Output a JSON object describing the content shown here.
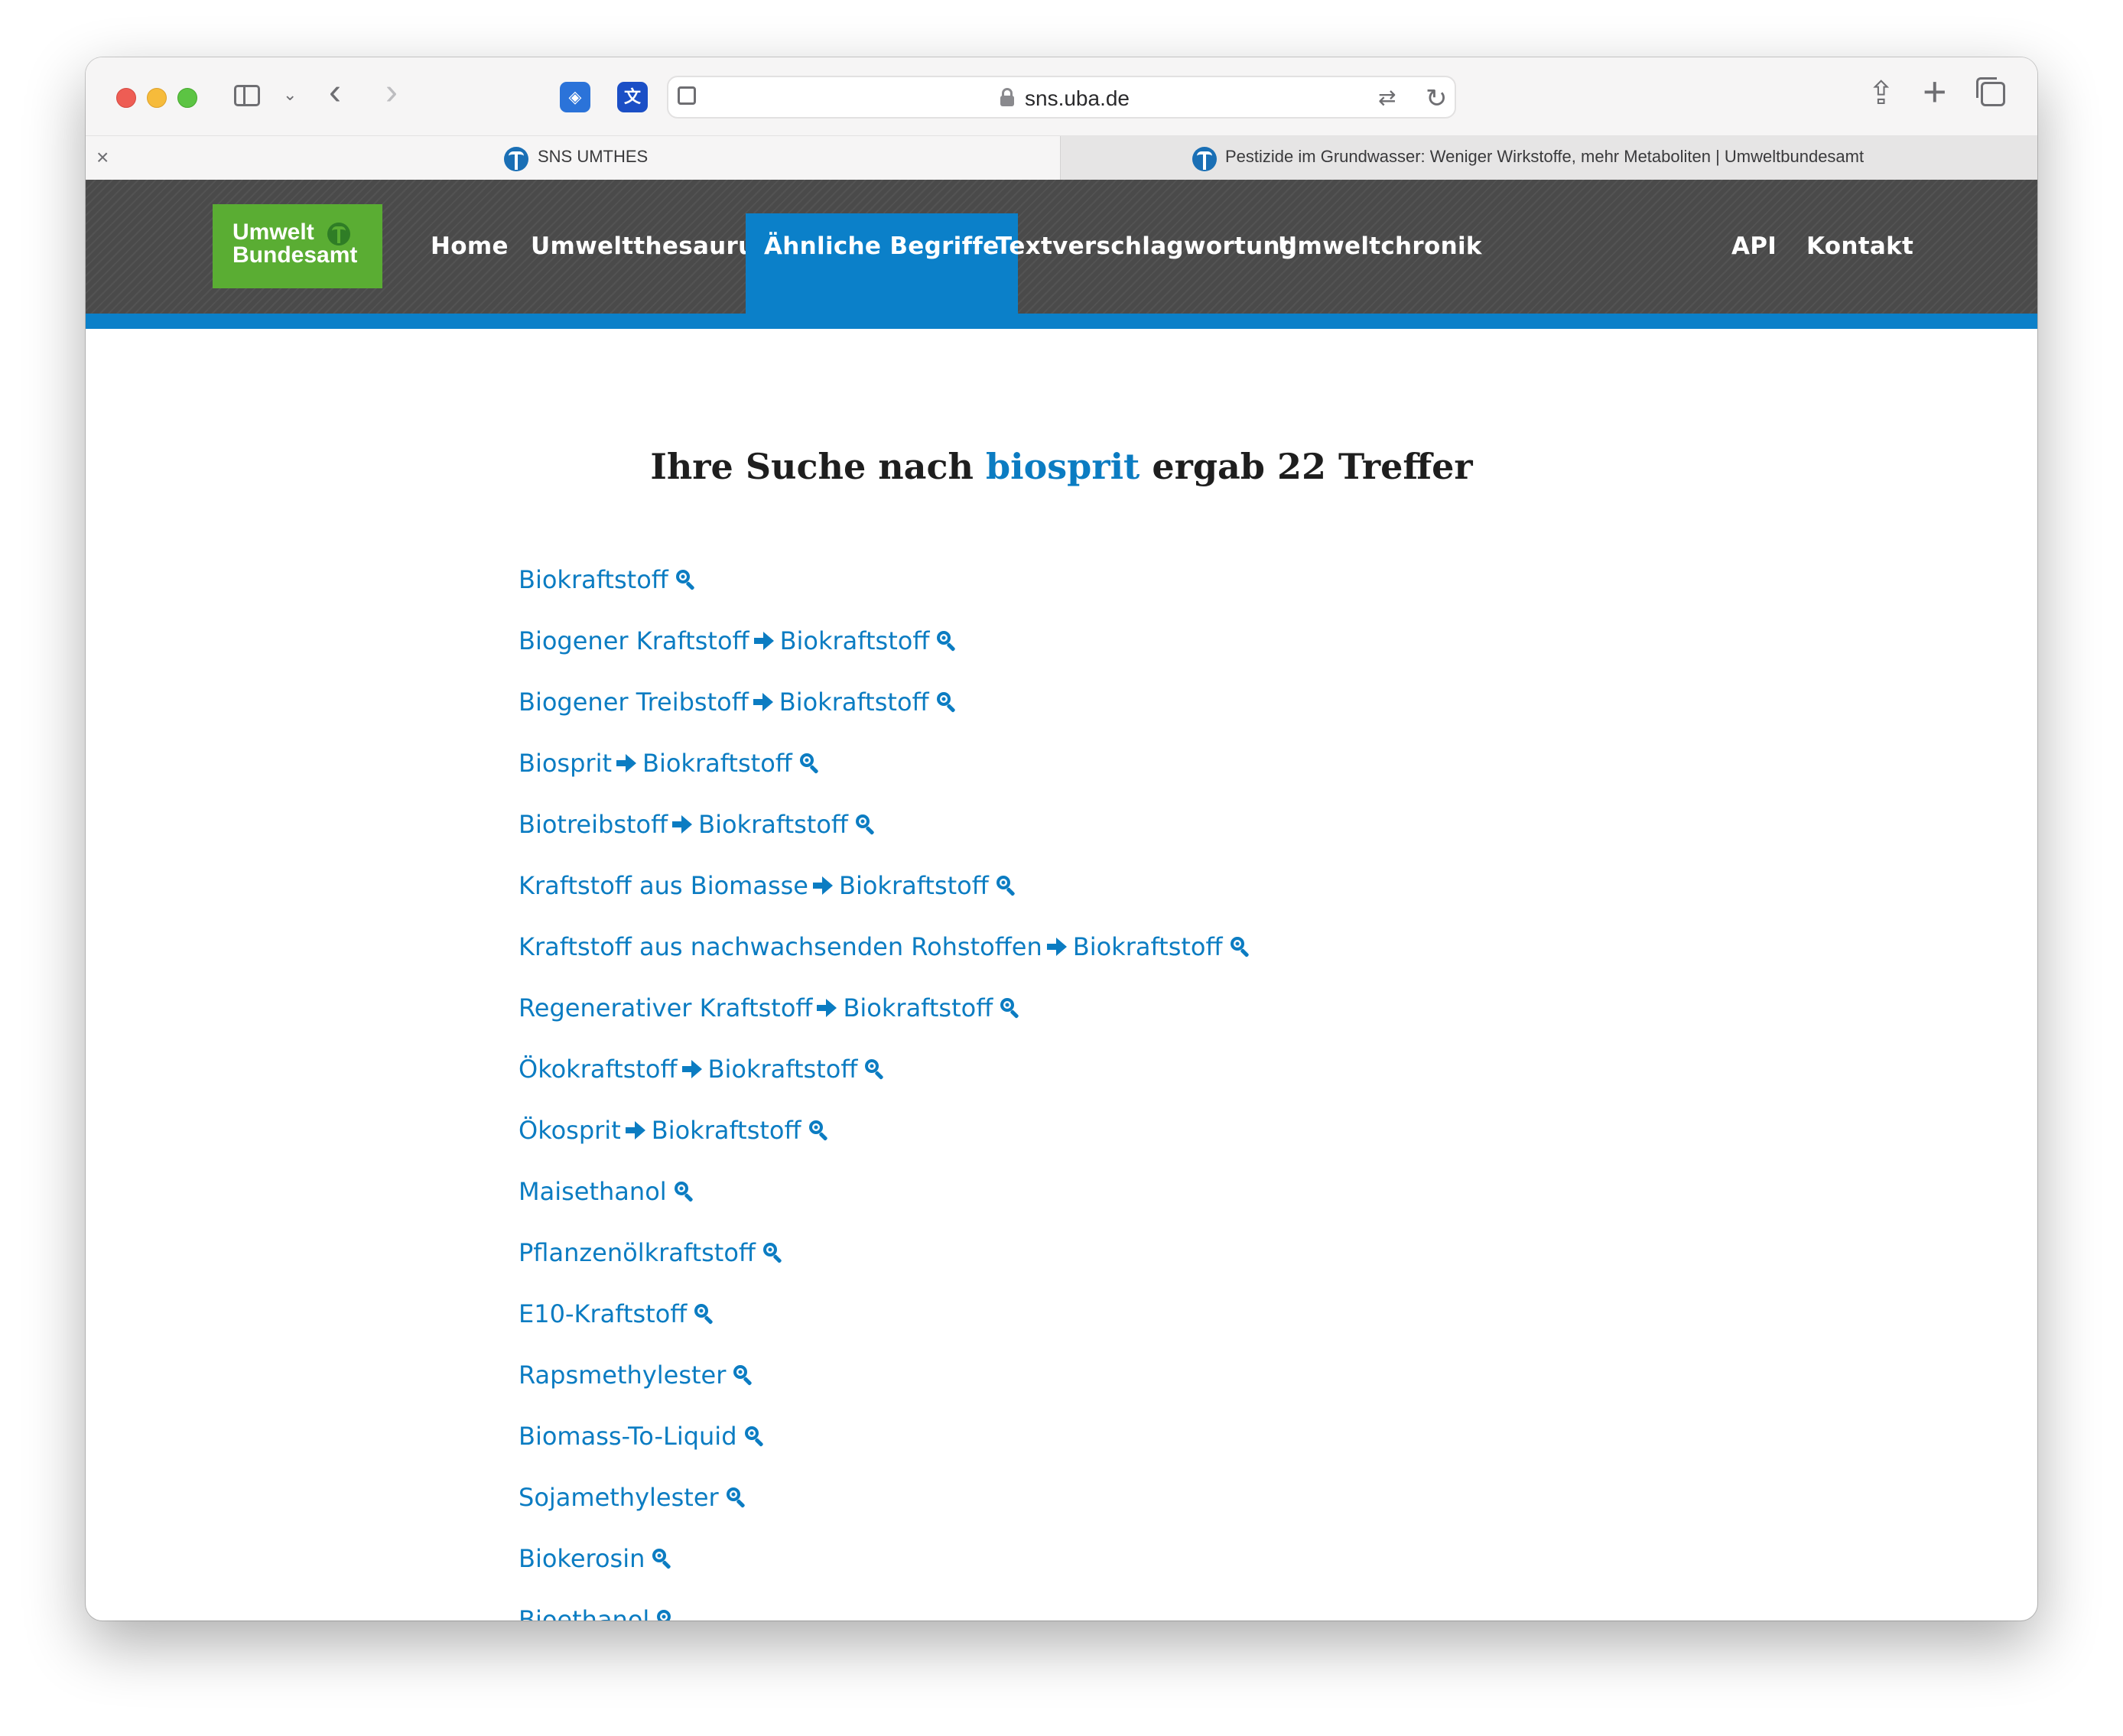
{
  "browser": {
    "url": "sns.uba.de",
    "tabs": [
      {
        "title": "SNS UMTHES"
      },
      {
        "title": "Pestizide im Grundwasser: Weniger Wirkstoffe, mehr Metaboliten | Umweltbundesamt"
      }
    ]
  },
  "site": {
    "logo_line1": "Umwelt",
    "logo_line2": "Bundesamt",
    "nav": [
      {
        "label": "Home"
      },
      {
        "label": "Umweltthesaurus"
      },
      {
        "label": "Ähnliche Begriffe",
        "active": true
      },
      {
        "label": "Textverschlagwortung"
      },
      {
        "label": "Umweltchronik"
      },
      {
        "label": "API"
      },
      {
        "label": "Kontakt"
      }
    ],
    "colors": {
      "nav_active": "#0b80c9",
      "logo_green": "#5aad33",
      "link": "#0b7cc2",
      "header_bg": "#4a4a4a"
    }
  },
  "search": {
    "heading_prefix": "Ihre Suche nach",
    "query": "biosprit",
    "heading_suffix": "ergab 22 Treffer"
  },
  "results": [
    {
      "term": "Biokraftstoff",
      "target": ""
    },
    {
      "term": "Biogener Kraftstoff",
      "target": "Biokraftstoff"
    },
    {
      "term": "Biogener Treibstoff",
      "target": "Biokraftstoff"
    },
    {
      "term": "Biosprit",
      "target": "Biokraftstoff"
    },
    {
      "term": "Biotreibstoff",
      "target": "Biokraftstoff"
    },
    {
      "term": "Kraftstoff aus Biomasse",
      "target": "Biokraftstoff"
    },
    {
      "term": "Kraftstoff aus nachwachsenden Rohstoffen",
      "target": "Biokraftstoff"
    },
    {
      "term": "Regenerativer Kraftstoff",
      "target": "Biokraftstoff"
    },
    {
      "term": "Ökokraftstoff",
      "target": "Biokraftstoff"
    },
    {
      "term": "Ökosprit",
      "target": "Biokraftstoff"
    },
    {
      "term": "Maisethanol",
      "target": ""
    },
    {
      "term": "Pflanzenölkraftstoff",
      "target": ""
    },
    {
      "term": "E10-Kraftstoff",
      "target": ""
    },
    {
      "term": "Rapsmethylester",
      "target": ""
    },
    {
      "term": "Biomass-To-Liquid",
      "target": ""
    },
    {
      "term": "Sojamethylester",
      "target": ""
    },
    {
      "term": "Biokerosin",
      "target": ""
    },
    {
      "term": "Bioethanol",
      "target": ""
    }
  ]
}
